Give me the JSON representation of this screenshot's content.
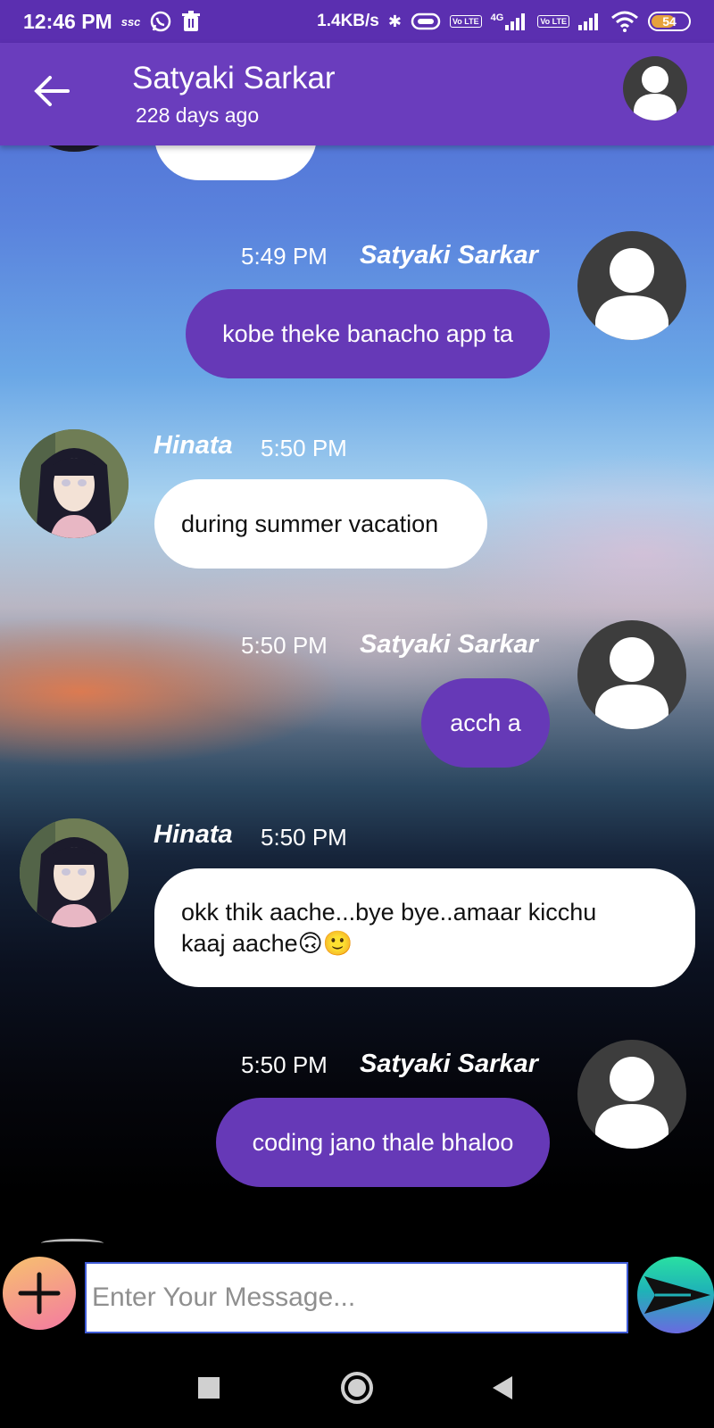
{
  "status_bar": {
    "time": "12:46 PM",
    "carrier_small": "ssc",
    "speed": "1.4KB/s",
    "lte_label": "Vo LTE",
    "network_type": "4G",
    "battery": "54"
  },
  "header": {
    "contact_name": "Satyaki Sarkar",
    "last_seen": "228 days ago"
  },
  "messages": [
    {
      "direction": "out",
      "time": "5:49 PM",
      "sender": "Satyaki Sarkar",
      "text": "kobe theke banacho app ta"
    },
    {
      "direction": "in",
      "time": "5:50 PM",
      "sender": "Hinata",
      "text": "during summer vacation"
    },
    {
      "direction": "out",
      "time": "5:50 PM",
      "sender": "Satyaki Sarkar",
      "text": "acch a"
    },
    {
      "direction": "in",
      "time": "5:50 PM",
      "sender": "Hinata",
      "text_line1": "okk thik aache...bye bye..amaar kicchu",
      "text_line2": "kaaj aache🙃🙂"
    },
    {
      "direction": "out",
      "time": "5:50 PM",
      "sender": "Satyaki Sarkar",
      "text": "coding jano thale bhaloo"
    }
  ],
  "input": {
    "placeholder": "Enter Your Message..."
  },
  "colors": {
    "status_bar": "#5b2fb0",
    "app_bar": "#6a3dbd",
    "outgoing_bubble": "#6639b7",
    "incoming_bubble": "#ffffff",
    "input_border": "#3f5bd6"
  },
  "icons": {
    "back": "arrow-left-icon",
    "avatar": "person-icon",
    "add": "plus-icon",
    "send": "send-icon",
    "nav_recents": "square-icon",
    "nav_home": "circle-icon",
    "nav_back": "triangle-icon"
  }
}
